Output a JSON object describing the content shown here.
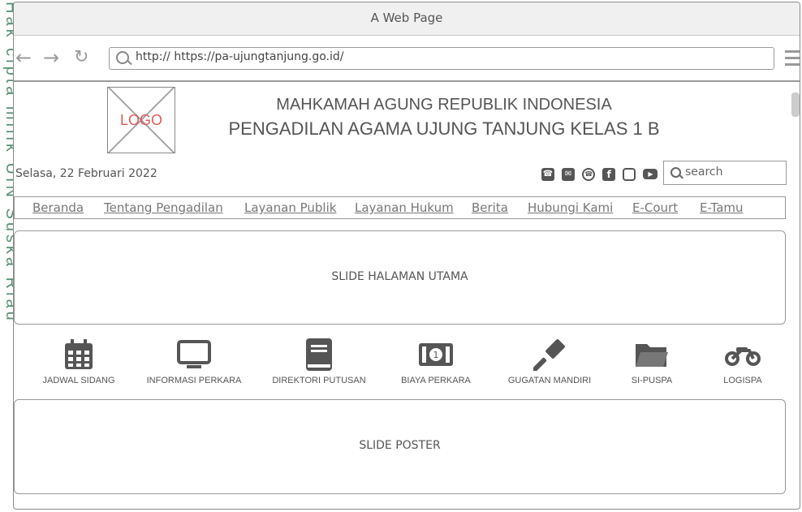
{
  "side_watermark": "Hak cipta milik UIN Suska Riau",
  "window": {
    "title": "A Web Page"
  },
  "browser": {
    "url": "http:// https://pa-ujungtanjung.go.id/"
  },
  "header": {
    "logo_text": "LOGO",
    "title_line1": "MAHKAMAH AGUNG REPUBLIK INDONESIA",
    "title_line2": "PENGADILAN AGAMA UJUNG TANJUNG KELAS 1 B"
  },
  "date": "Selasa, 22 Februari 2022",
  "search": {
    "placeholder": "search"
  },
  "social_icons": [
    "phone-icon",
    "mail-icon",
    "whatsapp-icon",
    "facebook-icon",
    "instagram-icon",
    "youtube-icon"
  ],
  "menu": [
    {
      "label": "Beranda"
    },
    {
      "label": "Tentang Pengadilan"
    },
    {
      "label": "Layanan Publik"
    },
    {
      "label": "Layanan Hukum"
    },
    {
      "label": "Berita"
    },
    {
      "label": "Hubungi Kami"
    },
    {
      "label": "E-Court"
    },
    {
      "label": "E-Tamu"
    }
  ],
  "slide_main": "SLIDE HALAMAN UTAMA",
  "services": [
    {
      "label": "JADWAL SIDANG",
      "icon": "calendar-icon"
    },
    {
      "label": "INFORMASI PERKARA",
      "icon": "monitor-icon"
    },
    {
      "label": "DIREKTORI PUTUSAN",
      "icon": "book-icon"
    },
    {
      "label": "BIAYA PERKARA",
      "icon": "money-icon"
    },
    {
      "label": "GUGATAN MANDIRI",
      "icon": "gavel-icon"
    },
    {
      "label": "SI-PUSPA",
      "icon": "folder-icon"
    },
    {
      "label": "LOGISPA",
      "icon": "motorcycle-icon"
    }
  ],
  "slide_poster": "SLIDE POSTER"
}
